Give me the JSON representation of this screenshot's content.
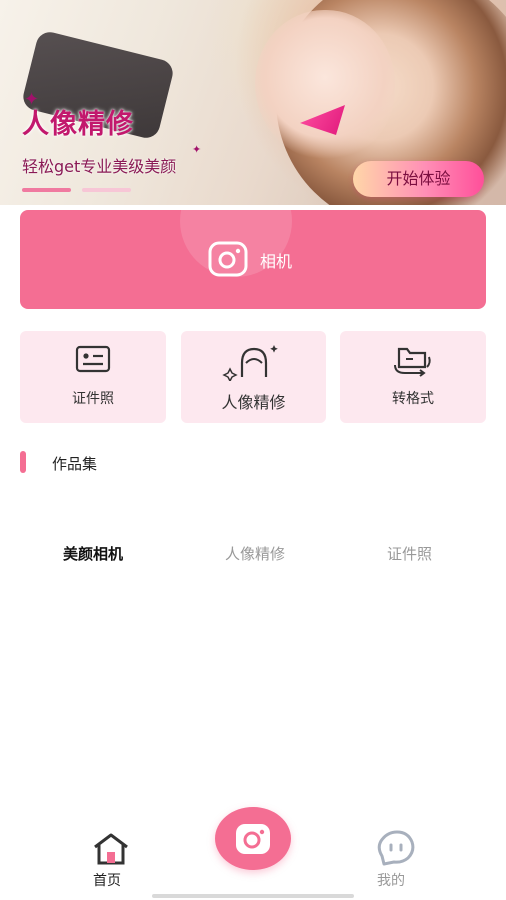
{
  "banner": {
    "title": "人像精修",
    "subtitle": "轻松get专业美级美颜",
    "cta_label": "开始体验",
    "page_count": 2,
    "active_page": 1
  },
  "camera_card": {
    "label": "相机",
    "icon": "camera-icon"
  },
  "features": [
    {
      "label": "证件照",
      "icon": "id-card-icon"
    },
    {
      "label": "人像精修",
      "icon": "portrait-retouch-icon"
    },
    {
      "label": "转格式",
      "icon": "format-convert-icon"
    }
  ],
  "works": {
    "title": "作品集",
    "filters": [
      "美颜相机",
      "人像精修",
      "证件照"
    ],
    "active_filter": "美颜相机"
  },
  "bottom_nav": {
    "home_label": "首页",
    "me_label": "我的",
    "active": "首页"
  },
  "colors": {
    "accent": "#f46e93",
    "tile_bg": "#fde8ef",
    "banner_title": "#c2186d",
    "inactive_text": "#999999"
  }
}
